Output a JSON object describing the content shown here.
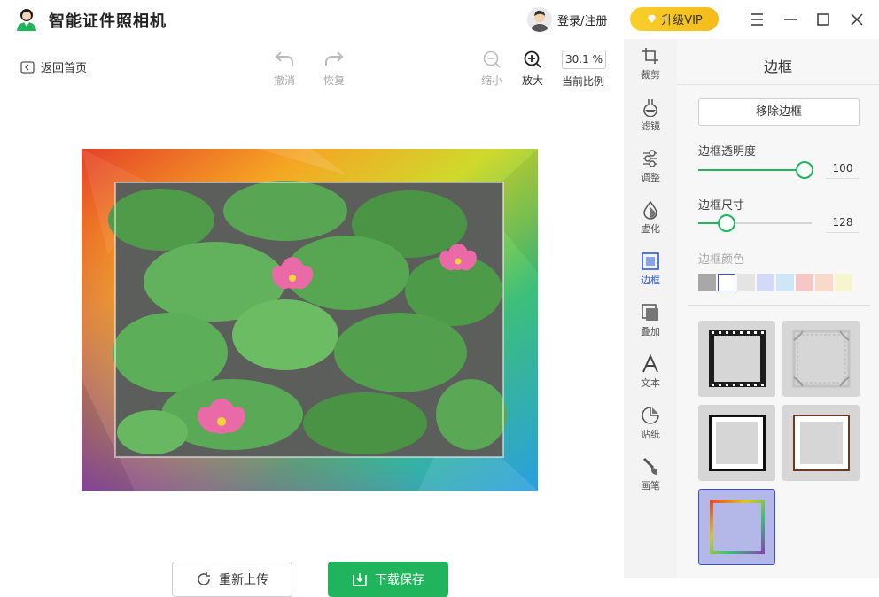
{
  "app": {
    "title": "智能证件照相机"
  },
  "header": {
    "login_label": "登录/注册",
    "vip_label": "升级VIP"
  },
  "toolbar": {
    "back_label": "返回首页",
    "undo_label": "撤消",
    "redo_label": "恢复",
    "zoom_out_label": "缩小",
    "zoom_in_label": "放大",
    "zoom_value": "30.1 %",
    "zoom_ratio_label": "当前比例"
  },
  "actions": {
    "reupload_label": "重新上传",
    "save_label": "下载保存"
  },
  "sidebar": {
    "items": [
      {
        "label": "裁剪",
        "icon": "crop-icon"
      },
      {
        "label": "滤镜",
        "icon": "flask-icon"
      },
      {
        "label": "调整",
        "icon": "sliders-icon"
      },
      {
        "label": "虚化",
        "icon": "drop-icon"
      },
      {
        "label": "边框",
        "icon": "frame-icon",
        "active": true
      },
      {
        "label": "叠加",
        "icon": "layers-icon"
      },
      {
        "label": "文本",
        "icon": "text-icon"
      },
      {
        "label": "贴纸",
        "icon": "sticker-icon"
      },
      {
        "label": "画笔",
        "icon": "brush-icon"
      }
    ]
  },
  "panel": {
    "title": "边框",
    "remove_border_label": "移除边框",
    "opacity": {
      "label": "边框透明度",
      "value": "100",
      "level": 1.0
    },
    "size": {
      "label": "边框尺寸",
      "value": "128",
      "level": 0.25
    },
    "color_label": "边框颜色",
    "swatches": [
      "#a8a8a8",
      "#ffffff",
      "#e4e4e4",
      "#d3daf9",
      "#cfe6f7",
      "#f5c8c8",
      "#f8d9cb",
      "#f7f5cf"
    ],
    "frames": [
      "film-frame",
      "ornate-frame",
      "black-white-frame",
      "wood-frame",
      "rainbow-frame"
    ]
  },
  "colors": {
    "accent": "#20b55c",
    "vip": "#f5c21b",
    "active": "#2a5bd7"
  }
}
